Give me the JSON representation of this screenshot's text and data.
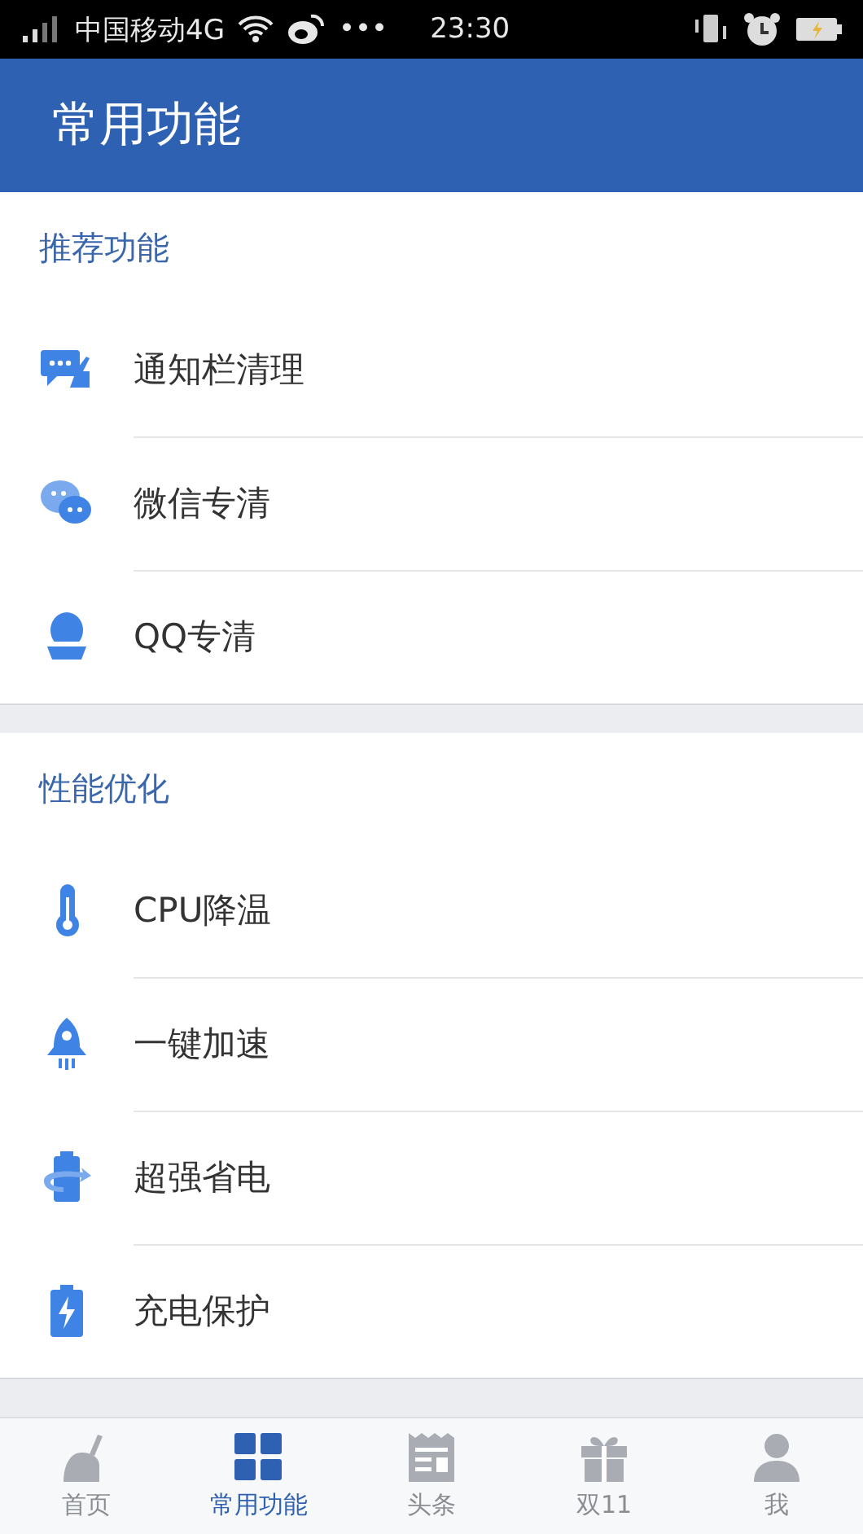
{
  "status_bar": {
    "carrier": "中国移动4G",
    "dots": "•••",
    "time": "23:30"
  },
  "header": {
    "title": "常用功能"
  },
  "sections": [
    {
      "title": "推荐功能",
      "items": [
        {
          "kind": "notify",
          "label": "通知栏清理"
        },
        {
          "kind": "chat",
          "label": "微信专清"
        },
        {
          "kind": "penguin",
          "label": "QQ专清"
        }
      ]
    },
    {
      "title": "性能优化",
      "items": [
        {
          "kind": "thermo",
          "label": "CPU降温"
        },
        {
          "kind": "rocket",
          "label": "一键加速"
        },
        {
          "kind": "battery_cycle",
          "label": "超强省电"
        },
        {
          "kind": "battery_bolt",
          "label": "充电保护"
        }
      ]
    }
  ],
  "tabs": [
    {
      "kind": "broom",
      "label": "首页",
      "selected": false
    },
    {
      "kind": "grid",
      "label": "常用功能",
      "selected": true
    },
    {
      "kind": "news",
      "label": "头条",
      "selected": false
    },
    {
      "kind": "gift",
      "label": "双11",
      "selected": false
    },
    {
      "kind": "person",
      "label": "我",
      "selected": false
    }
  ]
}
